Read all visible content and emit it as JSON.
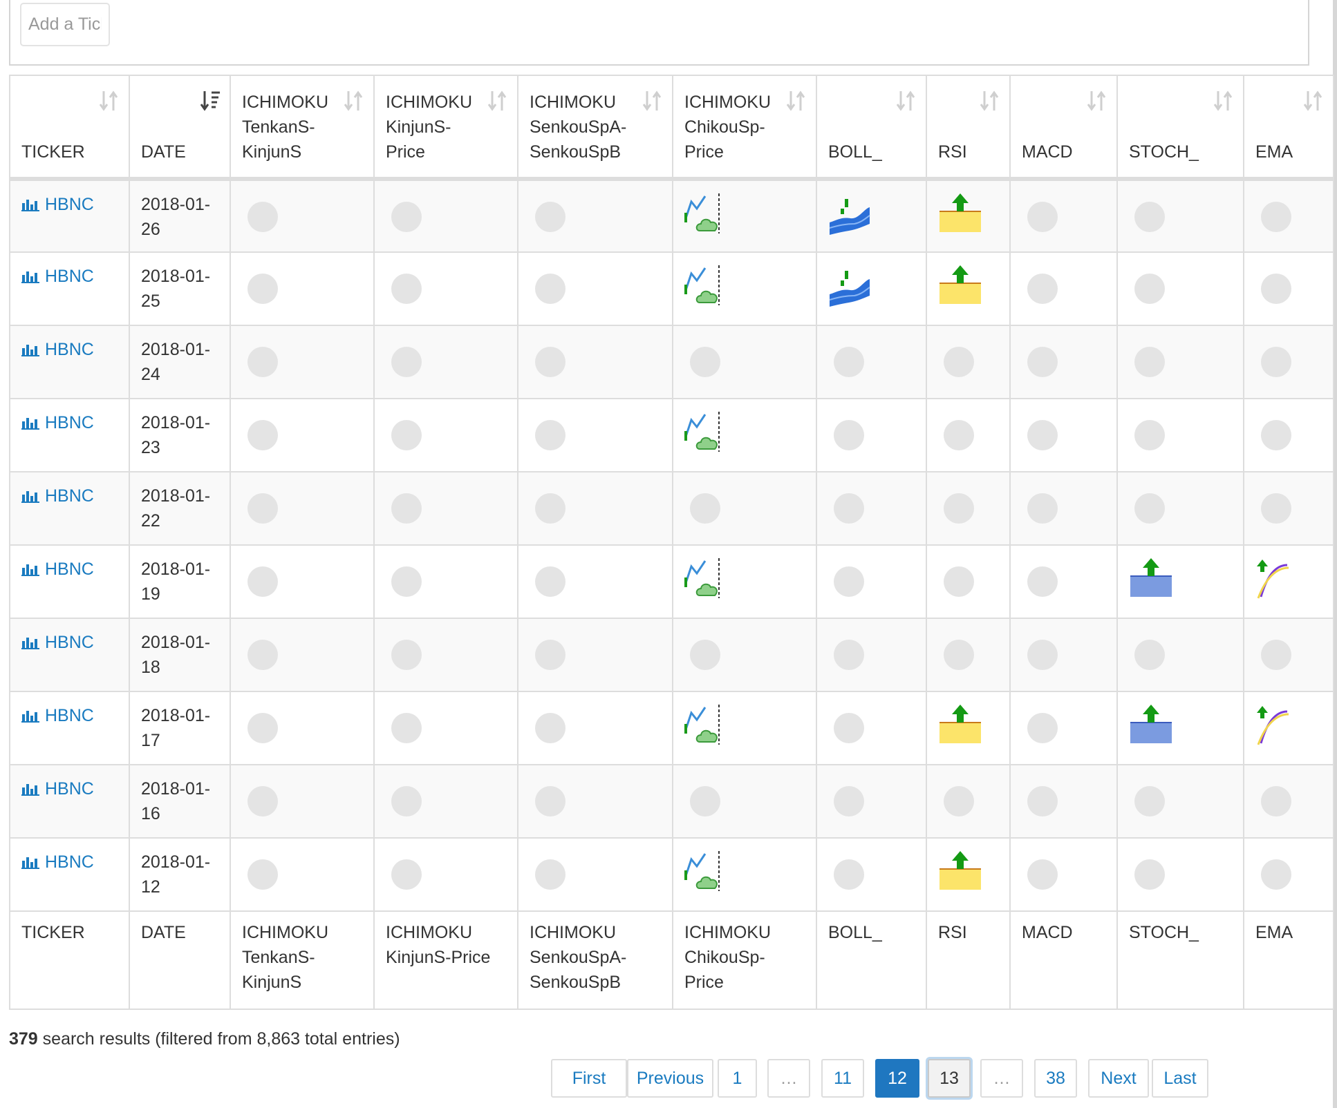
{
  "search": {
    "placeholder": "Add a Ticker"
  },
  "columns": [
    {
      "line1": "",
      "line2": "",
      "line3": "TICKER"
    },
    {
      "line1": "",
      "line2": "",
      "line3": "DATE"
    },
    {
      "line1": "ICHIMOKU",
      "line2": "TenkanS-",
      "line3": "KinjunS"
    },
    {
      "line1": "ICHIMOKU",
      "line2": "KinjunS-",
      "line3": "Price"
    },
    {
      "line1": "ICHIMOKU",
      "line2": "SenkouSpA-",
      "line3": "SenkouSpB"
    },
    {
      "line1": "ICHIMOKU",
      "line2": "ChikouSp-",
      "line3": "Price"
    },
    {
      "line1": "",
      "line2": "",
      "line3": "BOLL_"
    },
    {
      "line1": "",
      "line2": "",
      "line3": "RSI"
    },
    {
      "line1": "",
      "line2": "",
      "line3": "MACD"
    },
    {
      "line1": "",
      "line2": "",
      "line3": "STOCH_"
    },
    {
      "line1": "",
      "line2": "",
      "line3": "EMA"
    }
  ],
  "footer_columns": [
    {
      "line1": "TICKER",
      "line2": "",
      "line3": ""
    },
    {
      "line1": "DATE",
      "line2": "",
      "line3": ""
    },
    {
      "line1": "ICHIMOKU",
      "line2": "TenkanS-",
      "line3": "KinjunS"
    },
    {
      "line1": "ICHIMOKU",
      "line2": "KinjunS-Price",
      "line3": ""
    },
    {
      "line1": "ICHIMOKU",
      "line2": "SenkouSpA-",
      "line3": "SenkouSpB"
    },
    {
      "line1": "ICHIMOKU",
      "line2": "ChikouSp-",
      "line3": "Price"
    },
    {
      "line1": "BOLL_",
      "line2": "",
      "line3": ""
    },
    {
      "line1": "RSI",
      "line2": "",
      "line3": ""
    },
    {
      "line1": "MACD",
      "line2": "",
      "line3": ""
    },
    {
      "line1": "STOCH_",
      "line2": "",
      "line3": ""
    },
    {
      "line1": "EMA",
      "line2": "",
      "line3": ""
    }
  ],
  "rows": [
    {
      "ticker": "HBNC",
      "date_a": "2018-01-",
      "date_b": "26",
      "signals": [
        "none",
        "none",
        "none",
        "ichimoku-chikou-icon",
        "bollinger-icon",
        "rsi-up-icon",
        "none",
        "none",
        "none"
      ]
    },
    {
      "ticker": "HBNC",
      "date_a": "2018-01-",
      "date_b": "25",
      "signals": [
        "none",
        "none",
        "none",
        "ichimoku-chikou-icon",
        "bollinger-icon",
        "rsi-up-icon",
        "none",
        "none",
        "none"
      ]
    },
    {
      "ticker": "HBNC",
      "date_a": "2018-01-",
      "date_b": "24",
      "signals": [
        "none",
        "none",
        "none",
        "none",
        "none",
        "none",
        "none",
        "none",
        "none"
      ]
    },
    {
      "ticker": "HBNC",
      "date_a": "2018-01-",
      "date_b": "23",
      "signals": [
        "none",
        "none",
        "none",
        "ichimoku-chikou-icon",
        "none",
        "none",
        "none",
        "none",
        "none"
      ]
    },
    {
      "ticker": "HBNC",
      "date_a": "2018-01-",
      "date_b": "22",
      "signals": [
        "none",
        "none",
        "none",
        "none",
        "none",
        "none",
        "none",
        "none",
        "none"
      ]
    },
    {
      "ticker": "HBNC",
      "date_a": "2018-01-",
      "date_b": "19",
      "signals": [
        "none",
        "none",
        "none",
        "ichimoku-chikou-icon",
        "none",
        "none",
        "none",
        "stoch-up-icon",
        "ema-up-icon"
      ]
    },
    {
      "ticker": "HBNC",
      "date_a": "2018-01-",
      "date_b": "18",
      "signals": [
        "none",
        "none",
        "none",
        "none",
        "none",
        "none",
        "none",
        "none",
        "none"
      ]
    },
    {
      "ticker": "HBNC",
      "date_a": "2018-01-",
      "date_b": "17",
      "signals": [
        "none",
        "none",
        "none",
        "ichimoku-chikou-icon",
        "none",
        "rsi-up-icon",
        "none",
        "stoch-up-icon",
        "ema-up-icon"
      ]
    },
    {
      "ticker": "HBNC",
      "date_a": "2018-01-",
      "date_b": "16",
      "signals": [
        "none",
        "none",
        "none",
        "none",
        "none",
        "none",
        "none",
        "none",
        "none"
      ]
    },
    {
      "ticker": "HBNC",
      "date_a": "2018-01-",
      "date_b": "12",
      "signals": [
        "none",
        "none",
        "none",
        "ichimoku-chikou-icon",
        "none",
        "rsi-up-icon",
        "none",
        "none",
        "none"
      ]
    }
  ],
  "info": {
    "count": "379",
    "text": " search results (filtered from 8,863 total entries)"
  },
  "pagination": [
    {
      "label": "First",
      "state": "normal"
    },
    {
      "label": "Previous",
      "state": "normal"
    },
    {
      "label": "1",
      "state": "normal"
    },
    {
      "label": "…",
      "state": "ellipsis"
    },
    {
      "label": "11",
      "state": "normal"
    },
    {
      "label": "12",
      "state": "active"
    },
    {
      "label": "13",
      "state": "focus"
    },
    {
      "label": "…",
      "state": "ellipsis"
    },
    {
      "label": "38",
      "state": "normal"
    },
    {
      "label": "Next",
      "state": "normal"
    },
    {
      "label": "Last",
      "state": "normal"
    }
  ],
  "colors": {
    "link": "#1a7bc0",
    "active_page": "#1f77c0",
    "empty_signal": "#e4e4e4",
    "rsi_fill": "#fce46a",
    "stoch_fill": "#7b9be0",
    "arrow": "#149a14"
  }
}
